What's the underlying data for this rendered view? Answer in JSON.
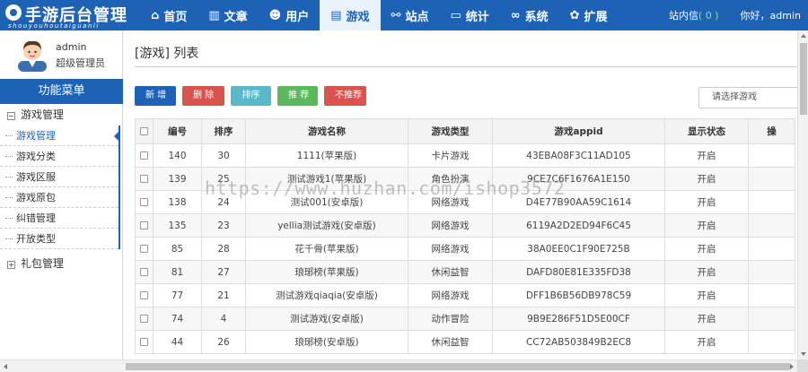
{
  "app": {
    "title": "手游后台管理",
    "subtitle": "shouyouhoutaiguanli"
  },
  "nav": [
    {
      "label": "首页",
      "icon": "home-icon",
      "glyph": "⌂"
    },
    {
      "label": "文章",
      "icon": "bar-chart-icon",
      "glyph": "▥"
    },
    {
      "label": "用户",
      "icon": "user-icon",
      "glyph": "☻"
    },
    {
      "label": "游戏",
      "icon": "document-icon",
      "glyph": "▤"
    },
    {
      "label": "站点",
      "icon": "share-icon",
      "glyph": "⚯"
    },
    {
      "label": "统计",
      "icon": "monitor-icon",
      "glyph": "▭"
    },
    {
      "label": "系统",
      "icon": "link-icon",
      "glyph": "∞"
    },
    {
      "label": "扩展",
      "icon": "gear-icon",
      "glyph": "✿"
    }
  ],
  "top_right": {
    "inbox_label": "站内信",
    "inbox_count": "( 0 )",
    "greeting": "你好，admin"
  },
  "sidebar": {
    "user_name": "admin",
    "user_role": "超级管理员",
    "menu_title": "功能菜单",
    "groups": [
      {
        "label": "游戏管理",
        "toggle": "−"
      },
      {
        "label": "礼包管理",
        "toggle": "+"
      }
    ],
    "items": [
      "游戏管理",
      "游戏分类",
      "游戏区服",
      "游戏原包",
      "纠错管理",
      "开放类型"
    ]
  },
  "main": {
    "page_title": "[游戏] 列表",
    "buttons": {
      "add": "新 增",
      "delete": "删 除",
      "sort": "排序",
      "recommend": "推 荐",
      "unrecommend": "不推荐"
    },
    "select_placeholder": "请选择游戏"
  },
  "table": {
    "headers": [
      "编号",
      "排序",
      "游戏名称",
      "游戏类型",
      "游戏appid",
      "显示状态",
      "操"
    ],
    "rows": [
      {
        "id": "140",
        "sort": "30",
        "name": "1111(苹果版)",
        "type": "卡片游戏",
        "appid": "43EBA08F3C11AD105",
        "status": "开启"
      },
      {
        "id": "139",
        "sort": "25",
        "name": "测试游戏1(苹果版)",
        "type": "角色扮演",
        "appid": "9CE7C6F1676A1E150",
        "status": "开启"
      },
      {
        "id": "138",
        "sort": "24",
        "name": "测试001(安卓版)",
        "type": "网络游戏",
        "appid": "D4E77B90AA59C1614",
        "status": "开启"
      },
      {
        "id": "135",
        "sort": "23",
        "name": "yellia测试游戏(安卓版)",
        "type": "网络游戏",
        "appid": "6119A2D2ED94F6C45",
        "status": "开启"
      },
      {
        "id": "85",
        "sort": "28",
        "name": "花千骨(苹果版)",
        "type": "网络游戏",
        "appid": "38A0EE0C1F90E725B",
        "status": "开启"
      },
      {
        "id": "81",
        "sort": "27",
        "name": "琅琊榜(苹果版)",
        "type": "休闲益智",
        "appid": "DAFD80E81E335FD38",
        "status": "开启"
      },
      {
        "id": "77",
        "sort": "21",
        "name": "测试游戏qiaqia(安卓版)",
        "type": "网络游戏",
        "appid": "DFF1B6B56DB978C59",
        "status": "开启"
      },
      {
        "id": "74",
        "sort": "4",
        "name": "测试游戏(安卓版)",
        "type": "动作冒险",
        "appid": "9B9E286F51D5E00CF",
        "status": "开启"
      },
      {
        "id": "44",
        "sort": "26",
        "name": "琅琊榜(安卓版)",
        "type": "休闲益智",
        "appid": "CC72AB503849B2EC8",
        "status": "开启"
      }
    ]
  },
  "watermark": "https://www.huzhan.com/ishop3572"
}
